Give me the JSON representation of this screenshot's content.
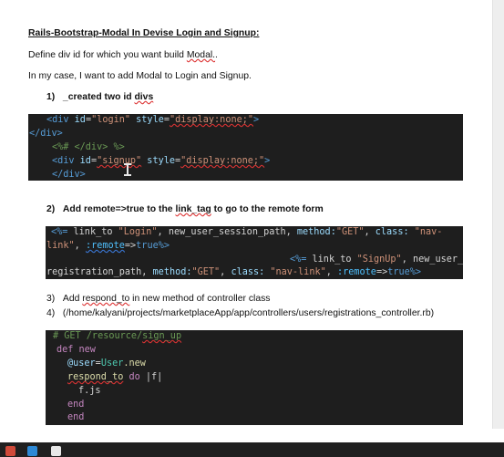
{
  "doc": {
    "heading": "Rails-Bootstrap-Modal In Devise Login and Signup:",
    "line1_prefix": "Define div id for which you want build ",
    "line1_link": "Modal.",
    "line1_suffix": ".",
    "line2": "In my case, I want to add Modal to Login and Signup.",
    "step1_num": "1)",
    "step1_pre": "_created two id ",
    "step1_sq": "divs",
    "step2_num": "2)",
    "step2_pre": "Add remote=>true to the ",
    "step2_sq": "link_tag",
    "step2_post": " to go to the remote form",
    "step3_num": "3)",
    "step3_pre": "Add ",
    "step3_sq": "respond_to",
    "step3_post": " in new method of controller class",
    "step4_num": "4)",
    "step4_text": "(/home/kalyani/projects/marketplaceApp/app/controllers/users/registrations_controller.rb)"
  },
  "code1": {
    "l1_a": "<div ",
    "l1_b": "id",
    "l1_c": "=",
    "l1_d": "\"login\"",
    "l1_e": " style",
    "l1_f": "=",
    "l1_g": "\"display:none;\"",
    "l1_h": ">",
    "l2": "</div>",
    "l3": "<%# </div> %>",
    "l4_a": "<div ",
    "l4_b": "id",
    "l4_c": "=",
    "l4_d": "\"signup\"",
    "l4_e": " style",
    "l4_f": "=",
    "l4_g": "\"display:none;\"",
    "l4_h": ">",
    "l5": "</div>"
  },
  "code2": {
    "a1": "<%=",
    "a2": " link_to ",
    "a3": "\"Login\"",
    "a4": ", new_user_session_path, ",
    "a5": "method:",
    "a6": "\"GET\"",
    "a7": ", ",
    "a8": "class:",
    "a9": " \"nav-",
    "b1": "link\"",
    "b2": ", ",
    "b3": ":remote",
    "b4": "=>",
    "b5": "true",
    "b6": "%>",
    "c1": "<%=",
    "c2": " link_to ",
    "c3": "\"SignUp\"",
    "c4": ", new_user_",
    "d1": "registration_path, ",
    "d2": "method:",
    "d3": "\"GET\"",
    "d4": ", ",
    "d5": "class:",
    "d6": " \"nav-link\"",
    "d7": ", ",
    "d8": ":remote",
    "d9": "=>",
    "d10": "true",
    "d11": "%>"
  },
  "code3": {
    "l1_a": "# GET /resource/",
    "l1_b": "sign_up",
    "l2": "def new",
    "l3_a": "@user",
    "l3_b": "=",
    "l3_c": "User",
    "l3_d": ".new",
    "l4_a": "respond_to",
    "l4_b": " do ",
    "l4_c": "|f|",
    "l5": "f.js",
    "l6": "end",
    "l7": "end"
  },
  "colors": {
    "code_bg": "#1e1e1e",
    "tag": "#569cd6",
    "string": "#ce9178",
    "comment": "#6a9955",
    "keyword": "#c586c0"
  }
}
